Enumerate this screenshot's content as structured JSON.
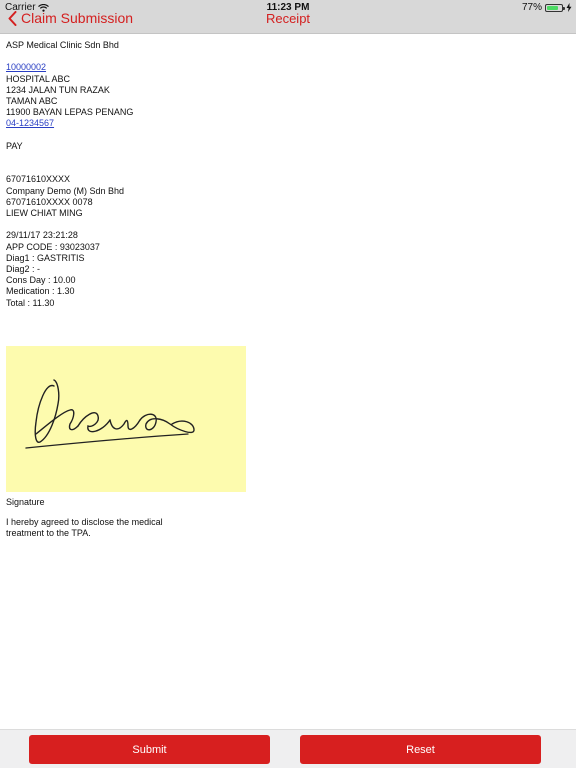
{
  "status_bar": {
    "carrier": "Carrier",
    "time": "11:23 PM",
    "battery_text": "77%",
    "battery_level": 0.77,
    "battery_color": "#4cd964"
  },
  "nav": {
    "back_label": "Claim Submission",
    "title": "Receipt",
    "accent_color": "#d42020"
  },
  "receipt": {
    "clinic_name": "ASP Medical Clinic Sdn Bhd",
    "clinic_code": "10000002",
    "address_lines": [
      "HOSPITAL ABC",
      "1234 JALAN TUN RAZAK",
      "TAMAN ABC",
      "11900 BAYAN LEPAS PENANG"
    ],
    "phone": "04-1234567",
    "pay_label": "PAY",
    "member_ic": "67071610XXXX",
    "company": "Company Demo (M) Sdn Bhd",
    "member_card": "67071610XXXX 0078",
    "member_name": "LIEW CHIAT MING",
    "datetime": "29/11/17 23:21:28",
    "app_code": "APP CODE : 93023037",
    "diag1": "Diag1 : GASTRITIS",
    "diag2": "Diag2 : -",
    "cons_day": "Cons Day : 10.00",
    "medication": "Medication : 1.30",
    "total": "Total : 11.30"
  },
  "signature": {
    "label": "Signature",
    "pad_color": "#fdfbae"
  },
  "disclosure": {
    "line1": "I hereby agreed to disclose the medical",
    "line2": "treatment to the TPA."
  },
  "actions": {
    "submit_label": "Submit",
    "reset_label": "Reset",
    "button_color": "#d71f1f"
  }
}
